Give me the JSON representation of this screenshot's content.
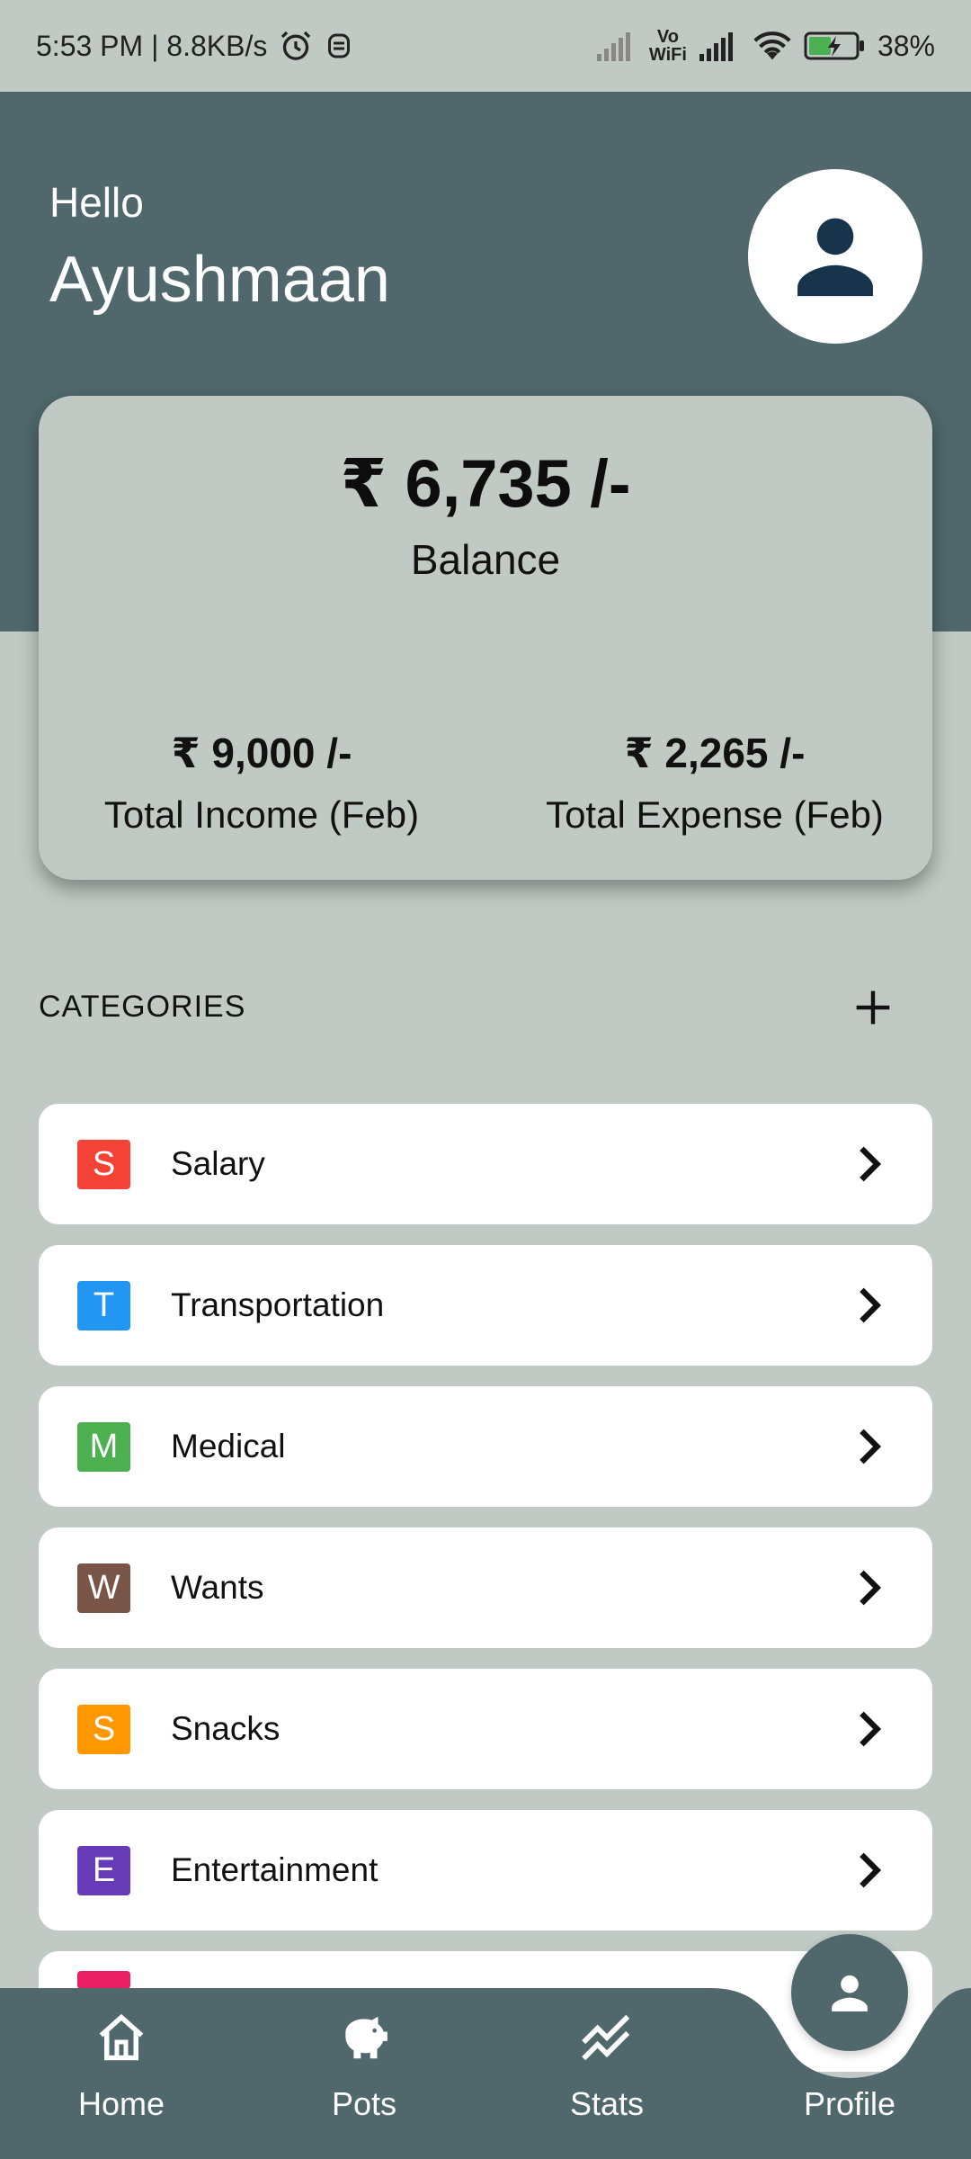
{
  "status_bar": {
    "time_speed": "5:53 PM | 8.8KB/s",
    "volte_top": "Vo",
    "volte_bottom": "WiFi",
    "battery": "38%"
  },
  "header": {
    "greeting": "Hello",
    "username": "Ayushmaan"
  },
  "balance_card": {
    "balance_amount": "₹ 6,735 /-",
    "balance_label": "Balance",
    "income_amount": "₹ 9,000 /-",
    "income_label": "Total Income (Feb)",
    "expense_amount": "₹ 2,265 /-",
    "expense_label": "Total Expense (Feb)"
  },
  "categories": {
    "title": "CATEGORIES",
    "items": [
      {
        "letter": "S",
        "name": "Salary",
        "color": "#f44336"
      },
      {
        "letter": "T",
        "name": "Transportation",
        "color": "#2196f3"
      },
      {
        "letter": "M",
        "name": "Medical",
        "color": "#4caf50"
      },
      {
        "letter": "W",
        "name": "Wants",
        "color": "#795548"
      },
      {
        "letter": "S",
        "name": "Snacks",
        "color": "#ff9800"
      },
      {
        "letter": "E",
        "name": "Entertainment",
        "color": "#673ab7"
      }
    ]
  },
  "bottom_nav": {
    "items": [
      {
        "label": "Home",
        "icon": "home-icon"
      },
      {
        "label": "Pots",
        "icon": "piggy-bank-icon"
      },
      {
        "label": "Stats",
        "icon": "stats-icon"
      },
      {
        "label": "Profile",
        "icon": "person-icon",
        "active": true
      }
    ]
  },
  "colors": {
    "header_bg": "#50686b",
    "page_bg": "#c1c9c5",
    "avatar_icon": "#18344c"
  }
}
